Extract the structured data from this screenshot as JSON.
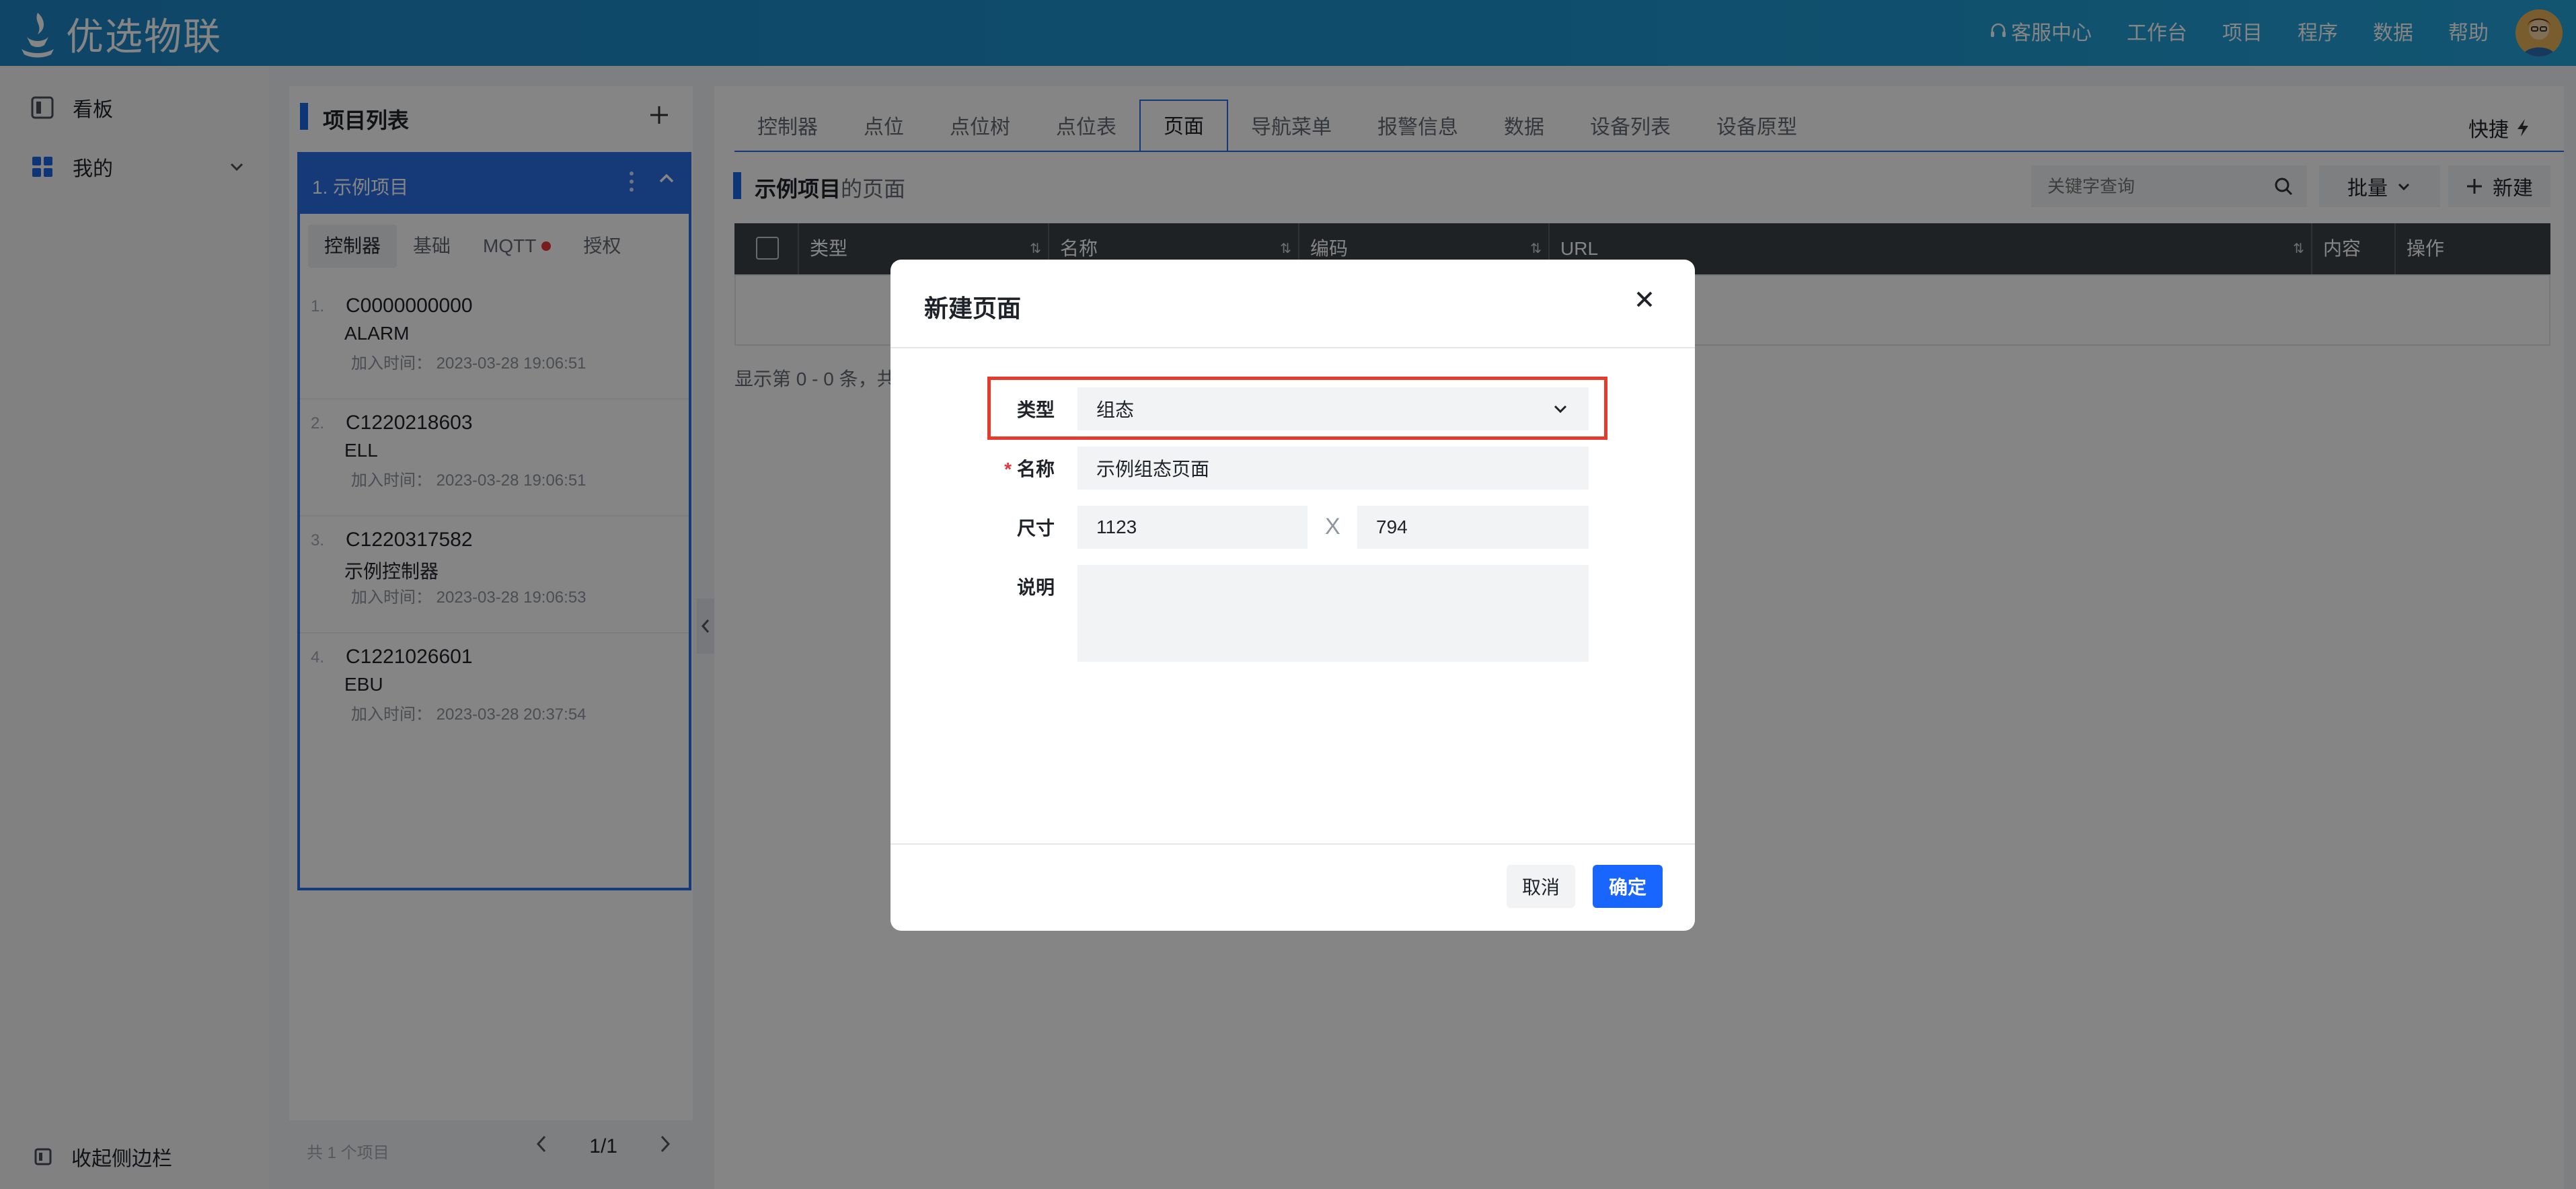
{
  "app": {
    "title": "优选物联"
  },
  "header": {
    "service_center": "客服中心",
    "nav": [
      "工作台",
      "项目",
      "程序",
      "数据",
      "帮助"
    ]
  },
  "sidebar": {
    "items": [
      {
        "label": "看板",
        "icon": "board-icon"
      },
      {
        "label": "我的",
        "icon": "grid-icon"
      }
    ],
    "collapse_label": "收起侧边栏"
  },
  "project_panel": {
    "title": "项目列表",
    "selected_project": "1.  示例项目",
    "tabs": [
      "控制器",
      "基础",
      "MQTT",
      "授权"
    ],
    "controllers": [
      {
        "num": "1.",
        "code": "C0000000000",
        "name": "ALARM",
        "time": "加入时间：  2023-03-28 19:06:51"
      },
      {
        "num": "2.",
        "code": "C1220218603",
        "name": "ELL",
        "time": "加入时间：  2023-03-28 19:06:51"
      },
      {
        "num": "3.",
        "code": "C1220317582",
        "name": "示例控制器",
        "time": "加入时间：  2023-03-28 19:06:53"
      },
      {
        "num": "4.",
        "code": "C1221026601",
        "name": "EBU",
        "time": "加入时间：  2023-03-28 20:37:54"
      }
    ],
    "footer_count": "共 1 个项目",
    "pager": "1/1"
  },
  "main": {
    "tabs": [
      "控制器",
      "点位",
      "点位树",
      "点位表",
      "页面",
      "导航菜单",
      "报警信息",
      "数据",
      "设备列表",
      "设备原型"
    ],
    "active_tab": "页面",
    "quick_label": "快捷",
    "page_title_strong": "示例项目",
    "page_title_rest": "的页面",
    "search_placeholder": "关键字查询",
    "batch_label": "批量",
    "new_label": "新建",
    "table_headers": [
      "类型",
      "名称",
      "编码",
      "URL",
      "内容",
      "操作"
    ],
    "table_info": "显示第 0 - 0 条，共"
  },
  "dialog": {
    "title": "新建页面",
    "fields": {
      "type_label": "类型",
      "type_value": "组态",
      "name_label": "名称",
      "name_value": "示例组态页面",
      "size_label": "尺寸",
      "width_value": "1123",
      "size_sep": "X",
      "height_value": "794",
      "desc_label": "说明",
      "desc_value": ""
    },
    "cancel_label": "取消",
    "ok_label": "确定"
  },
  "colors": {
    "accent": "#2b6fe6",
    "primary_button": "#1966ff",
    "highlight": "#e53b2c",
    "header": "#1e95d0"
  }
}
